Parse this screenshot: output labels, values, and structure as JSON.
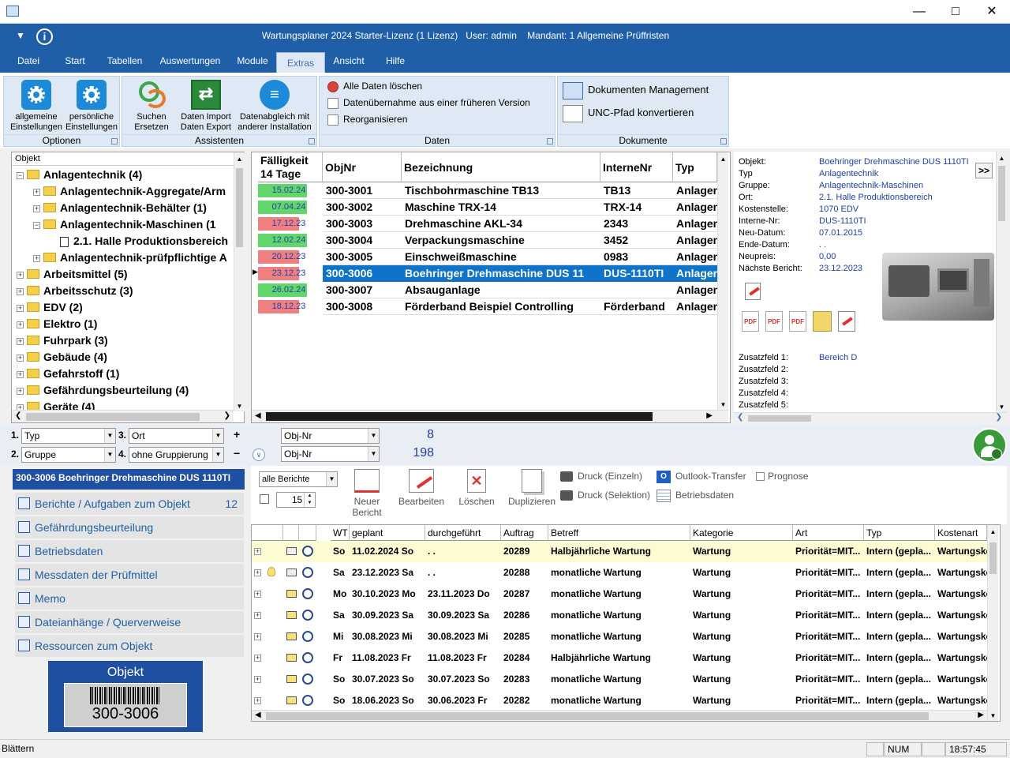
{
  "window": {
    "title": "Wartungsplaner 2024 Starter-Lizenz (1 Lizenz)   User: admin    Mandant: 1 Allgemeine Prüffristen"
  },
  "menu": [
    "Datei",
    "Start",
    "Tabellen",
    "Auswertungen",
    "Module",
    "Extras",
    "Ansicht",
    "Hilfe"
  ],
  "ribbon": {
    "optionen": {
      "label": "Optionen",
      "btn1": "allgemeine\nEinstellungen",
      "btn2": "persönliche\nEinstellungen"
    },
    "assistenten": {
      "label": "Assistenten",
      "btn1": "Suchen\nErsetzen",
      "btn2": "Daten Import\nDaten Export",
      "btn3": "Datenabgleich mit\nanderer Installation"
    },
    "daten": {
      "label": "Daten",
      "item1": "Alle Daten löschen",
      "item2": "Datenübernahme aus einer früheren Version",
      "item3": "Reorganisieren"
    },
    "dokumente": {
      "label": "Dokumente",
      "item1": "Dokumenten Management",
      "item2": "UNC-Pfad konvertieren"
    }
  },
  "tree": {
    "header": "Objekt",
    "nodes": [
      {
        "text": "Anlagentechnik  (4)",
        "level": 0,
        "exp": "−"
      },
      {
        "text": "Anlagentechnik-Aggregate/Arm",
        "level": 1,
        "exp": "+"
      },
      {
        "text": "Anlagentechnik-Behälter  (1)",
        "level": 1,
        "exp": "+"
      },
      {
        "text": "Anlagentechnik-Maschinen  (1",
        "level": 1,
        "exp": "−"
      },
      {
        "text": "2.1. Halle Produktionsbereich",
        "level": 2,
        "exp": ""
      },
      {
        "text": "Anlagentechnik-prüfpflichtige A",
        "level": 1,
        "exp": "+"
      },
      {
        "text": "Arbeitsmittel  (5)",
        "level": 0,
        "exp": "+"
      },
      {
        "text": "Arbeitsschutz  (3)",
        "level": 0,
        "exp": "+"
      },
      {
        "text": "EDV  (2)",
        "level": 0,
        "exp": "+"
      },
      {
        "text": "Elektro  (1)",
        "level": 0,
        "exp": "+"
      },
      {
        "text": "Fuhrpark  (3)",
        "level": 0,
        "exp": "+"
      },
      {
        "text": "Gebäude  (4)",
        "level": 0,
        "exp": "+"
      },
      {
        "text": "Gefahrstoff  (1)",
        "level": 0,
        "exp": "+"
      },
      {
        "text": "Gefährdungsbeurteilung  (4)",
        "level": 0,
        "exp": "+"
      },
      {
        "text": "Geräte  (4)",
        "level": 0,
        "exp": "+"
      }
    ]
  },
  "grid": {
    "headers": {
      "due": "Fälligkeit\n14 Tage",
      "objnr": "ObjNr",
      "bez": "Bezeichnung",
      "intern": "InterneNr",
      "typ": "Typ"
    },
    "rows": [
      {
        "due": "15.02.24",
        "status": "green",
        "objnr": "300-3001",
        "bez": "Tischbohrmaschine TB13",
        "intern": "TB13",
        "typ": "Anlagen"
      },
      {
        "due": "07.04.24",
        "status": "green",
        "objnr": "300-3002",
        "bez": "Maschine TRX-14",
        "intern": "TRX-14",
        "typ": "Anlagen"
      },
      {
        "due": "17.12.23",
        "status": "red",
        "objnr": "300-3003",
        "bez": "Drehmaschine AKL-34",
        "intern": "2343",
        "typ": "Anlagen"
      },
      {
        "due": "12.02.24",
        "status": "green",
        "objnr": "300-3004",
        "bez": "Verpackungsmaschine",
        "intern": "3452",
        "typ": "Anlagen"
      },
      {
        "due": "20.12.23",
        "status": "red",
        "objnr": "300-3005",
        "bez": "Einschweißmaschine",
        "intern": "0983",
        "typ": "Anlagen"
      },
      {
        "due": "23.12.23",
        "status": "red",
        "objnr": "300-3006",
        "bez": "Boehringer Drehmaschine DUS 11",
        "intern": "DUS-1110TI",
        "typ": "Anlagen",
        "selected": true
      },
      {
        "due": "26.02.24",
        "status": "green",
        "objnr": "300-3007",
        "bez": "Absauganlage",
        "intern": "",
        "typ": "Anlagen"
      },
      {
        "due": "18.12.23",
        "status": "red",
        "objnr": "300-3008",
        "bez": "Förderband Beispiel Controlling",
        "intern": "Förderband",
        "typ": "Anlagen"
      }
    ]
  },
  "info": {
    "labels": [
      "Objekt:",
      "Typ",
      "Gruppe:",
      "Ort:",
      "Kostenstelle:",
      "Interne-Nr:",
      "Neu-Datum:",
      "Ende-Datum:",
      "Neupreis:",
      "Nächste Bericht:"
    ],
    "values": [
      "Boehringer Drehmaschine DUS 1110TI",
      "Anlagentechnik",
      "Anlagentechnik-Maschinen",
      "2.1. Halle Produktionsbereich",
      "1070 EDV",
      "DUS-1110TI",
      "07.01.2015",
      ". .",
      "0,00",
      "23.12.2023"
    ],
    "more_btn": ">>",
    "extra_labels": [
      "Zusatzfeld 1:",
      "Zusatzfeld 2:",
      "Zusatzfeld 3:",
      "Zusatzfeld 4:",
      "Zusatzfeld 5:"
    ],
    "extra_values": [
      "Bereich D",
      "",
      "",
      "",
      ""
    ]
  },
  "filters": {
    "n1": "1.",
    "f1": "Typ",
    "n2": "2.",
    "f2": "Gruppe",
    "n3": "3.",
    "f3": "Ort",
    "n4": "4.",
    "f4": "ohne Gruppierung",
    "sort1": "Obj-Nr",
    "sort2": "Obj-Nr",
    "count1": "8",
    "count2": "198"
  },
  "nav": {
    "title": "300-3006 Boehringer Drehmaschine DUS 1110TI",
    "items": [
      {
        "label": "Berichte / Aufgaben zum Objekt",
        "count": "12"
      },
      {
        "label": "Gefährdungsbeurteilung",
        "count": ""
      },
      {
        "label": "Betriebsdaten",
        "count": ""
      },
      {
        "label": "Messdaten der Prüfmittel",
        "count": ""
      },
      {
        "label": "Memo",
        "count": ""
      },
      {
        "label": "Dateianhänge / Querverweise",
        "count": ""
      },
      {
        "label": "Ressourcen zum Objekt",
        "count": ""
      }
    ],
    "label_title": "Objekt",
    "label_code": "300-3006"
  },
  "reports_toolbar": {
    "filter": "alle Berichte",
    "spin": "15",
    "new": "Neuer\nBericht",
    "edit": "Bearbeiten",
    "delete": "Löschen",
    "dup": "Duplizieren",
    "print1": "Druck (Einzeln)",
    "print2": "Druck (Selektion)",
    "outlook": "Outlook-Transfer",
    "betrieb": "Betriebsdaten",
    "prognose": "Prognose"
  },
  "reports": {
    "headers": [
      "WT",
      "geplant",
      "durchgeführt",
      "Auftrag",
      "Betreff",
      "Kategorie",
      "Art",
      "Typ",
      "Kostenart"
    ],
    "rows": [
      {
        "bulb": false,
        "mail": "open",
        "wt": "So",
        "geplant": "11.02.2024 So",
        "durch": ". .",
        "auftrag": "20289",
        "betreff": "Halbjährliche Wartung",
        "kat": "Wartung",
        "art": "Priorität=MIT...",
        "typ": "Intern (gepla...",
        "kost": "Wartungskosten",
        "hl": true
      },
      {
        "bulb": true,
        "mail": "open",
        "wt": "Sa",
        "geplant": "23.12.2023 Sa",
        "durch": ". .",
        "auftrag": "20288",
        "betreff": "monatliche Wartung",
        "kat": "Wartung",
        "art": "Priorität=MIT...",
        "typ": "Intern (gepla...",
        "kost": "Wartungskosten"
      },
      {
        "bulb": false,
        "mail": "closed",
        "wt": "Mo",
        "geplant": "30.10.2023 Mo",
        "durch": "23.11.2023 Do",
        "auftrag": "20287",
        "betreff": "monatliche Wartung",
        "kat": "Wartung",
        "art": "Priorität=MIT...",
        "typ": "Intern (gepla...",
        "kost": "Wartungskosten"
      },
      {
        "bulb": false,
        "mail": "closed",
        "wt": "Sa",
        "geplant": "30.09.2023 Sa",
        "durch": "30.09.2023 Sa",
        "auftrag": "20286",
        "betreff": "monatliche Wartung",
        "kat": "Wartung",
        "art": "Priorität=MIT...",
        "typ": "Intern (gepla...",
        "kost": "Wartungskosten"
      },
      {
        "bulb": false,
        "mail": "closed",
        "wt": "Mi",
        "geplant": "30.08.2023 Mi",
        "durch": "30.08.2023 Mi",
        "auftrag": "20285",
        "betreff": "monatliche Wartung",
        "kat": "Wartung",
        "art": "Priorität=MIT...",
        "typ": "Intern (gepla...",
        "kost": "Wartungskosten"
      },
      {
        "bulb": false,
        "mail": "closed",
        "wt": "Fr",
        "geplant": "11.08.2023 Fr",
        "durch": "11.08.2023 Fr",
        "auftrag": "20284",
        "betreff": "Halbjährliche Wartung",
        "kat": "Wartung",
        "art": "Priorität=MIT...",
        "typ": "Intern (gepla...",
        "kost": "Wartungskosten"
      },
      {
        "bulb": false,
        "mail": "closed",
        "wt": "So",
        "geplant": "30.07.2023 So",
        "durch": "30.07.2023 So",
        "auftrag": "20283",
        "betreff": "monatliche Wartung",
        "kat": "Wartung",
        "art": "Priorität=MIT...",
        "typ": "Intern (gepla...",
        "kost": "Wartungskosten"
      },
      {
        "bulb": false,
        "mail": "closed",
        "wt": "So",
        "geplant": "18.06.2023 So",
        "durch": "30.06.2023 Fr",
        "auftrag": "20282",
        "betreff": "monatliche Wartung",
        "kat": "Wartung",
        "art": "Priorität=MIT...",
        "typ": "Intern (gepla...",
        "kost": "Wartungskosten"
      }
    ]
  },
  "status": {
    "left": "Blättern",
    "num": "NUM",
    "time": "18:57:45"
  },
  "colors": {
    "accent": "#1f5fa8",
    "selection": "#0f74c8",
    "due_green": "#63d66b",
    "due_red": "#f08080"
  }
}
